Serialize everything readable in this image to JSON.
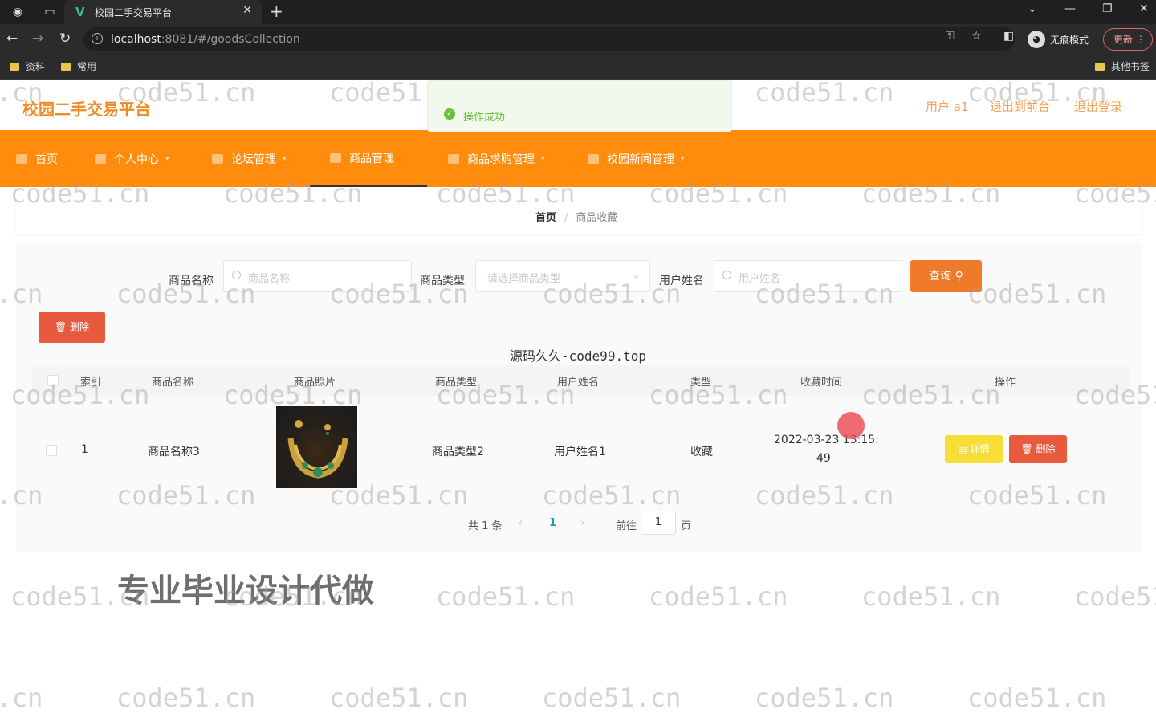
{
  "browser": {
    "tab_title": "校园二手交易平台",
    "url_host": "localhost",
    "url_path": ":8081/#/goodsCollection",
    "incognito_label": "无痕模式",
    "update_label": "更新",
    "bookmarks": [
      "资料",
      "常用"
    ],
    "other_bookmarks": "其他书签"
  },
  "header": {
    "site_title": "校园二手交易平台",
    "user_label": "用户 a1",
    "back_to_front": "退出到前台",
    "logout": "退出登录"
  },
  "toast": {
    "message": "操作成功"
  },
  "nav": {
    "items": [
      {
        "label": "首页"
      },
      {
        "label": "个人中心"
      },
      {
        "label": "论坛管理"
      },
      {
        "label": "商品管理"
      },
      {
        "label": "商品求购管理"
      },
      {
        "label": "校园新闻管理"
      }
    ]
  },
  "breadcrumb": {
    "home": "首页",
    "separator": "/",
    "current": "商品收藏"
  },
  "filters": {
    "goods_name_label": "商品名称",
    "goods_name_placeholder": "商品名称",
    "goods_type_label": "商品类型",
    "goods_type_placeholder": "请选择商品类型",
    "user_name_label": "用户姓名",
    "user_name_placeholder": "用户姓名",
    "query_button": "查询"
  },
  "actions": {
    "delete_button": "删除"
  },
  "watermark_center": "源码久久-code99.top",
  "table": {
    "columns": [
      "索引",
      "商品名称",
      "商品照片",
      "商品类型",
      "用户姓名",
      "类型",
      "收藏时间",
      "操作"
    ],
    "rows": [
      {
        "index": "1",
        "goods_name": "商品名称3",
        "goods_type": "商品类型2",
        "user_name": "用户姓名1",
        "type": "收藏",
        "time_line1": "2022-03-23 13:15:",
        "time_line2": "49",
        "detail_button": "详情",
        "delete_button": "删除"
      }
    ]
  },
  "pagination": {
    "total": "共 1 条",
    "current_page": "1",
    "goto_label": "前往",
    "goto_value": "1",
    "page_suffix": "页"
  },
  "overlay_text": "专业毕业设计代做",
  "watermark": "code51.cn",
  "colors": {
    "accent": "#ff8c0d",
    "title": "#ef8a25",
    "danger": "#e85a3e",
    "warning": "#f8dd36",
    "success": "#67c23a"
  }
}
